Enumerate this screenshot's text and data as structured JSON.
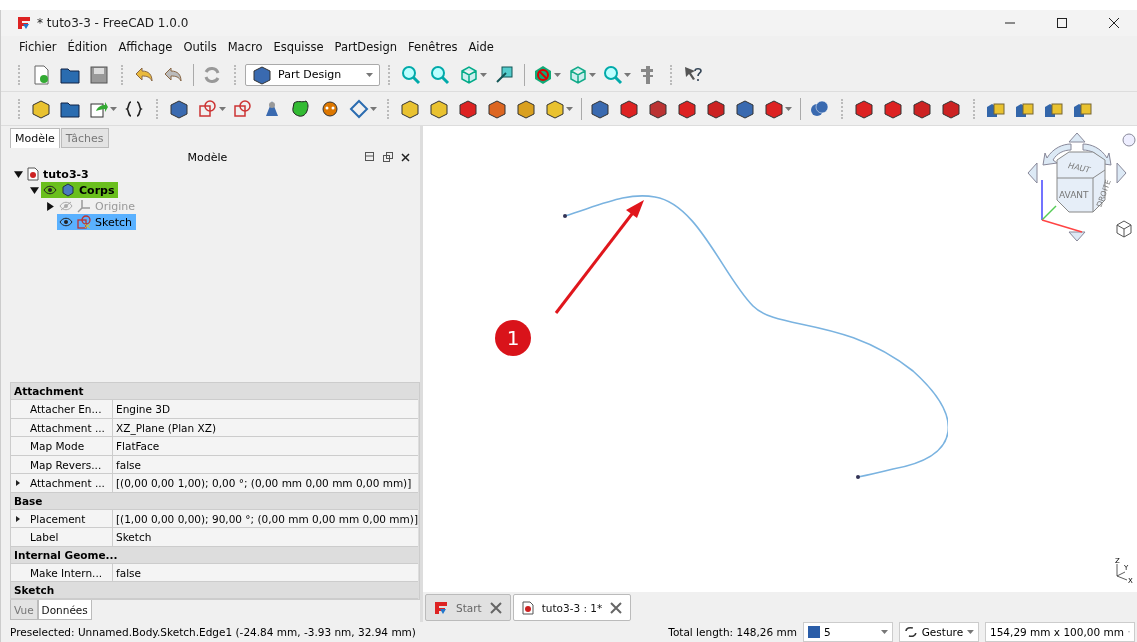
{
  "window": {
    "title": "* tuto3-3 - FreeCAD 1.0.0"
  },
  "menu": [
    "Fichier",
    "Édition",
    "Affichage",
    "Outils",
    "Macro",
    "Esquisse",
    "PartDesign",
    "Fenêtres",
    "Aide"
  ],
  "workbench": {
    "value": "Part Design"
  },
  "combo_view": {
    "tabs": [
      {
        "label": "Modèle",
        "selected": true
      },
      {
        "label": "Tâches",
        "selected": false
      }
    ],
    "title": "Modèle",
    "tree": [
      {
        "label": "tuto3-3",
        "kind": "document",
        "expanded": true,
        "selected": false,
        "active": false,
        "visible": true,
        "children": [
          {
            "label": "Corps",
            "kind": "body",
            "expanded": true,
            "selected": false,
            "active": true,
            "visible": true,
            "children": [
              {
                "label": "Origine",
                "kind": "origin",
                "expanded": false,
                "selected": false,
                "active": false,
                "visible": false
              },
              {
                "label": "Sketch",
                "kind": "sketch",
                "selected": true,
                "active": false,
                "visible": true
              }
            ]
          }
        ]
      }
    ]
  },
  "properties": [
    {
      "kind": "group",
      "name": "Attachment"
    },
    {
      "kind": "property",
      "name": "Attacher En...",
      "value": "Engine 3D"
    },
    {
      "kind": "property",
      "name": "Attachment ...",
      "value": "XZ_Plane (Plan XZ)"
    },
    {
      "kind": "property",
      "name": "Map Mode",
      "value": "FlatFace"
    },
    {
      "kind": "property",
      "name": "Map Revers...",
      "value": "false"
    },
    {
      "kind": "compound",
      "name": "Attachment ...",
      "value": "[(0,00 0,00 1,00); 0,00 °; (0,00 mm  0,00 mm  0,00 mm)]"
    },
    {
      "kind": "group",
      "name": "Base"
    },
    {
      "kind": "compound",
      "name": "Placement",
      "value": "[(1,00 0,00 0,00); 90,00 °; (0,00 mm  0,00 mm  0,00 mm)]"
    },
    {
      "kind": "property",
      "name": "Label",
      "value": "Sketch"
    },
    {
      "kind": "group",
      "name": "Internal Geome..."
    },
    {
      "kind": "property",
      "name": "Make Intern...",
      "value": "false"
    },
    {
      "kind": "group",
      "name": "Sketch"
    }
  ],
  "property_tabs": [
    {
      "label": "Vue",
      "selected": false
    },
    {
      "label": "Données",
      "selected": true
    }
  ],
  "view": {
    "badge": "1",
    "cube_faces": [
      "HAUT",
      "AVANT",
      "DROITE"
    ],
    "axes": [
      "Z",
      "Y",
      "X"
    ]
  },
  "doc_tabs": [
    {
      "label": "Start",
      "kind": "start",
      "selected": false
    },
    {
      "label": "tuto3-3 : 1*",
      "kind": "document",
      "selected": true
    }
  ],
  "status_bar": {
    "message": "Preselected: Unnamed.Body.Sketch.Edge1 (-24.84 mm, -3.93 nm, 32.94 mm)",
    "total_length": "Total length: 148,26 mm",
    "draw_style": "5",
    "navigation": "Gesture",
    "dimensions": "154,29 mm x 100,00 mm"
  }
}
